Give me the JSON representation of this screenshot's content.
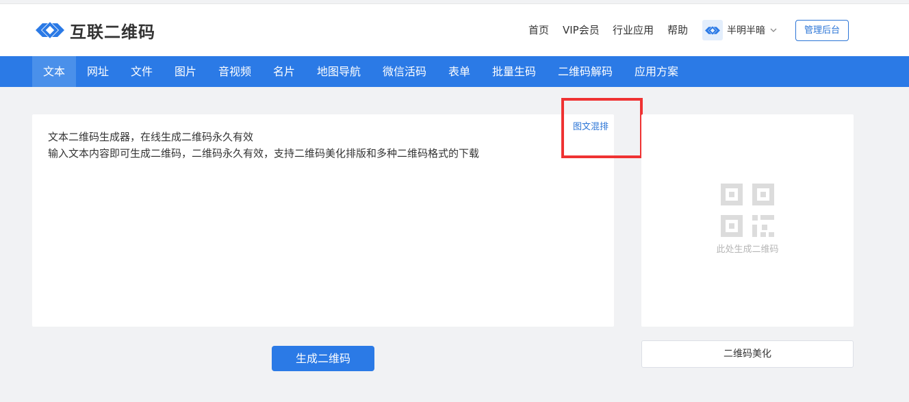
{
  "brand": {
    "name": "互联二维码",
    "accent": "#2b7ae6"
  },
  "top_nav": [
    {
      "label": "首页"
    },
    {
      "label": "VIP会员"
    },
    {
      "label": "行业应用"
    },
    {
      "label": "帮助"
    }
  ],
  "user": {
    "name": "半明半暗",
    "menu_icon": "chevron-down-icon"
  },
  "admin_button": "管理后台",
  "main_tabs": [
    {
      "label": "文本",
      "active": true
    },
    {
      "label": "网址"
    },
    {
      "label": "文件"
    },
    {
      "label": "图片"
    },
    {
      "label": "音视频"
    },
    {
      "label": "名片"
    },
    {
      "label": "地图导航"
    },
    {
      "label": "微信活码"
    },
    {
      "label": "表单"
    },
    {
      "label": "批量生码"
    },
    {
      "label": "二维码解码"
    },
    {
      "label": "应用方案"
    }
  ],
  "editor": {
    "lines": [
      "文本二维码生成器，在线生成二维码永久有效",
      "输入文本内容即可生成二维码，二维码永久有效，支持二维码美化排版和多种二维码格式的下载"
    ],
    "mix_link": "图文混排"
  },
  "qr_preview": {
    "caption": "此处生成二维码",
    "icon": "qr-code-icon"
  },
  "generate_button": "生成二维码",
  "beautify_button": "二维码美化",
  "colors": {
    "nav_bg": "#2b7ae6",
    "active_tab": "#4a90ea",
    "highlight": "#ef3232",
    "link": "#2a74d6"
  }
}
